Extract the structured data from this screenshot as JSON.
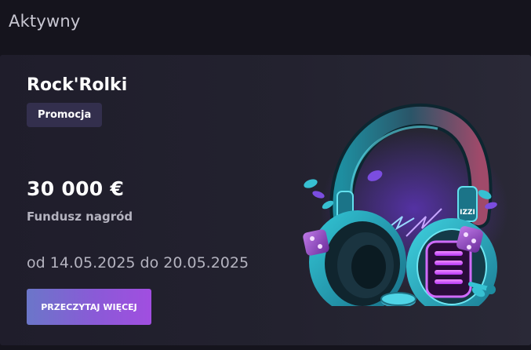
{
  "section": {
    "title": "Aktywny"
  },
  "promotion": {
    "title": "Rock'Rolki",
    "badge": "Promocja",
    "prize_amount": "30 000 €",
    "prize_label": "Fundusz nagród",
    "date_range": "od 14.05.2025 do 20.05.2025",
    "cta_label": "PRZECZYTAJ WIĘCEJ",
    "image": {
      "icon": "headphones-icon",
      "brand_text": "IZZI"
    }
  },
  "colors": {
    "background": "#15141d",
    "card": "#23222f",
    "badge": "#332f4d",
    "cta_start": "#6b76c9",
    "cta_end": "#a14ee0",
    "accent_cyan": "#2fc6d6",
    "accent_purple": "#b04cf0"
  }
}
